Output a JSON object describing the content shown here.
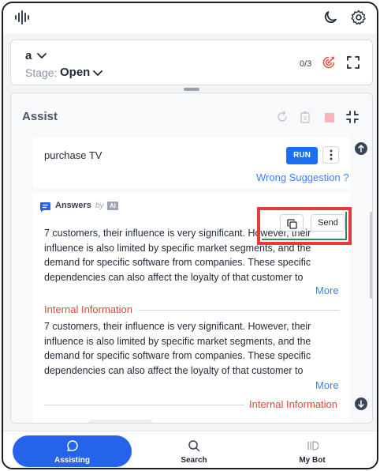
{
  "header": {
    "logo_icon": "waveform-icon",
    "theme_icon": "moon-icon",
    "settings_icon": "gear-icon"
  },
  "stage_card": {
    "name": "a",
    "stage_label": "Stage:",
    "stage_value": "Open",
    "count": "0/3",
    "target_icon": "target-icon",
    "expand_icon": "fullscreen-icon"
  },
  "assist": {
    "title": "Assist",
    "suggestion": {
      "text": "purchase TV",
      "run_label": "RUN",
      "wrong_link": "Wrong Suggestion ?"
    },
    "answers": {
      "label": "Answers",
      "by": "by",
      "ai_badge": "AI",
      "copy_icon": "copy-icon",
      "send_label": "Send",
      "paragraph_1": "7 customers, their influence is very significant. However, their influence is also limited by specific market segments, and the demand for specific software from companies. These specific dependencies can also affect the loyalty of that customer to",
      "more_1": "More",
      "internal_1": "Internal Information",
      "paragraph_2": "7 customers, their influence is very significant. However, their influence is also limited by specific market segments, and the demand for specific software from companies. These specific dependencies can also affect the loyalty of that customer to",
      "more_2": "More",
      "internal_2": "Internal Information"
    }
  },
  "nav": {
    "assisting": "Assisting",
    "search": "Search",
    "mybot": "My Bot"
  },
  "colors": {
    "accent": "#2563eb",
    "run": "#1d6ff2",
    "link": "#3b82f6",
    "internal": "#dc4a3b",
    "highlight": "#e23b3b"
  }
}
